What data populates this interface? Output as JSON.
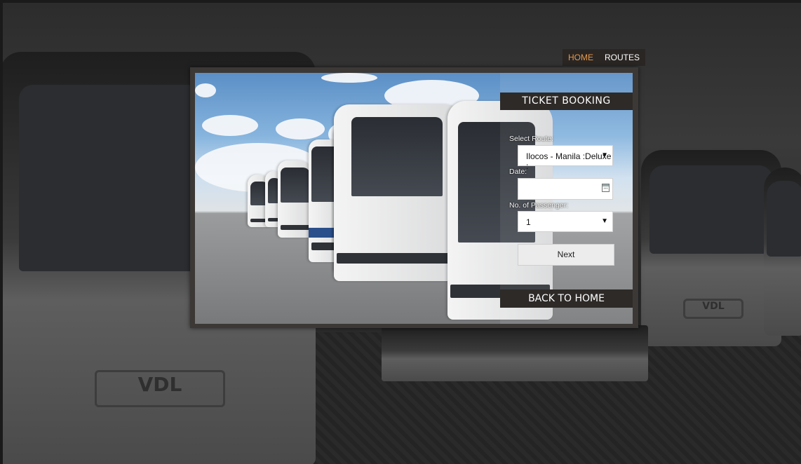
{
  "nav": {
    "items": [
      {
        "label": "HOME",
        "active": true
      },
      {
        "label": "ROUTES",
        "active": false
      }
    ]
  },
  "booking": {
    "title": "TICKET BOOKING",
    "route_label": "Select Route:",
    "route_value": "Ilocos - Manila :Deluxe :",
    "date_label": "Date:",
    "date_value": "",
    "passenger_label": "No. of Passenger:",
    "passenger_value": "1",
    "next_label": "Next",
    "back_label": "BACK TO HOME"
  },
  "background": {
    "bus_logo": "VDL"
  },
  "colors": {
    "accent": "#e59a4a",
    "panel": "#3b3836",
    "header_bar": "#2d2a28"
  },
  "icons": {
    "dropdown": "chevron-down-icon",
    "date": "calendar-icon"
  }
}
